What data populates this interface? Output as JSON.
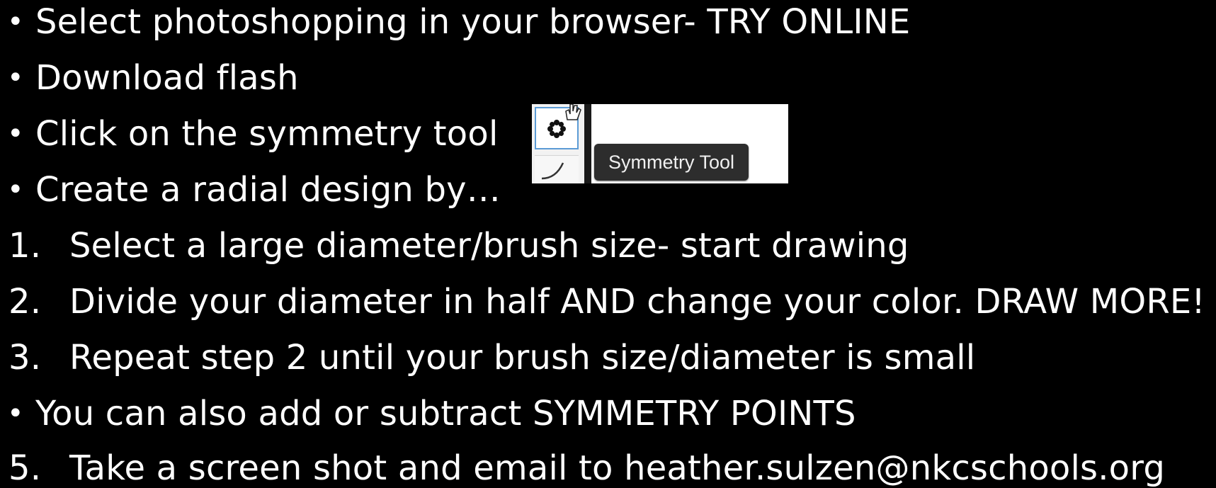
{
  "slide": {
    "lines": [
      {
        "marker": "•",
        "text": "Select photoshopping in your browser- TRY ONLINE"
      },
      {
        "marker": "•",
        "text": "Download flash"
      },
      {
        "marker": "•",
        "text": "Click on the symmetry tool"
      },
      {
        "marker": "•",
        "text": "Create a radial design by…"
      },
      {
        "marker": "1.",
        "text": "Select a large diameter/brush size- start drawing"
      },
      {
        "marker": "2.",
        "text": "Divide your diameter in half AND change your color. DRAW MORE!"
      },
      {
        "marker": "3.",
        "text": "Repeat step 2 until your brush size/diameter is small"
      },
      {
        "marker": "•",
        "text": "You can also add or subtract SYMMETRY POINTS"
      },
      {
        "marker": "5.",
        "text": "Take a screen shot and email to heather.sulzen@nkcschools.org"
      }
    ]
  },
  "tool_inset": {
    "tooltip": "Symmetry Tool",
    "icon": "symmetry-flower-icon",
    "highlight_color": "#5b9bd5"
  },
  "colors": {
    "background": "#000000",
    "text": "#ffffff",
    "tooltip_bg": "#2d2d2d"
  }
}
